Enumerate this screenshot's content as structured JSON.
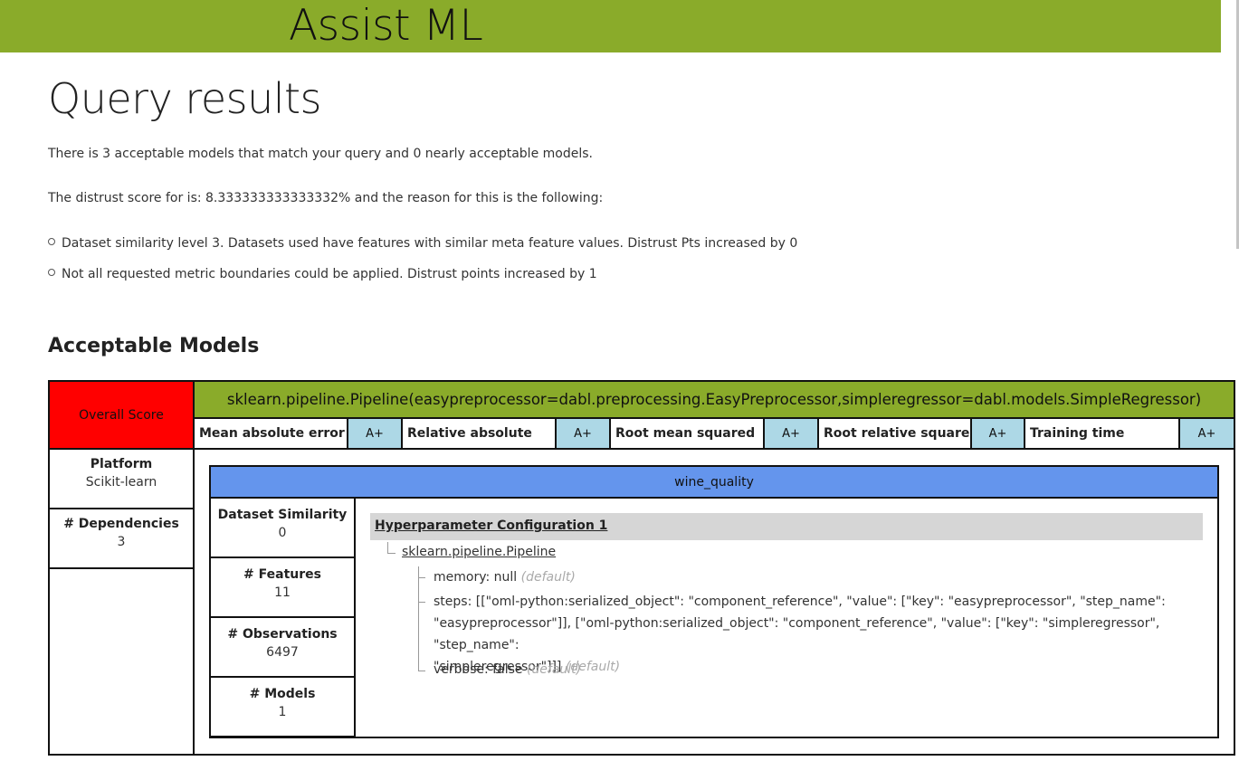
{
  "app": {
    "title": "Assist ML"
  },
  "page": {
    "title": "Query results",
    "summary": "There is 3 acceptable models that match your query and 0 nearly acceptable models.",
    "distrust_text": "The distrust score for is: 8.333333333333332% and the reason for this is the following:",
    "reasons": [
      "Dataset similarity level 3. Datasets used have features with similar meta feature values. Distrust Pts increased by 0",
      "Not all requested metric boundaries could be applied. Distrust points increased by 1"
    ]
  },
  "section": {
    "heading": "Acceptable Models"
  },
  "model": {
    "overall_score_label": "Overall Score",
    "pipeline_name": "sklearn.pipeline.Pipeline(easypreprocessor=dabl.preprocessing.EasyPreprocessor,simpleregressor=dabl.models.SimpleRegressor)",
    "metrics": [
      {
        "label": "Mean absolute error",
        "grade": "A+"
      },
      {
        "label": "Relative absolute",
        "grade": "A+"
      },
      {
        "label": "Root mean squared",
        "grade": "A+"
      },
      {
        "label": "Root relative squared",
        "grade": "A+"
      },
      {
        "label": "Training time",
        "grade": "A+"
      }
    ],
    "platform_label": "Platform",
    "platform_value": "Scikit-learn",
    "dependencies_label": "# Dependencies",
    "dependencies_value": "3"
  },
  "dataset": {
    "name": "wine_quality",
    "similarity_label": "Dataset Similarity",
    "similarity_value": "0",
    "features_label": "# Features",
    "features_value": "11",
    "observations_label": "# Observations",
    "observations_value": "6497",
    "models_label": "# Models",
    "models_value": "1"
  },
  "hyperparameters": {
    "config_label": "Hyperparameter Configuration 1",
    "pipeline_link": "sklearn.pipeline.Pipeline",
    "default_tag": "(default)",
    "params": [
      {
        "text": "memory: null"
      },
      {
        "line1": "steps: [[\"oml-python:serialized_object\": \"component_reference\", \"value\": [\"key\": \"easypreprocessor\", \"step_name\":",
        "line2": "\"easypreprocessor\"]], [\"oml-python:serialized_object\": \"component_reference\", \"value\": [\"key\": \"simpleregressor\", \"step_name\":",
        "line3": "\"simpleregressor\"]]]"
      },
      {
        "text": "verbose: false"
      }
    ]
  },
  "colors": {
    "header_green": "#8aab2a",
    "overall_red": "#ff0000",
    "grade_blue": "#add8e6",
    "dataset_blue": "#6495ed",
    "hp_gray": "#d6d6d6"
  }
}
